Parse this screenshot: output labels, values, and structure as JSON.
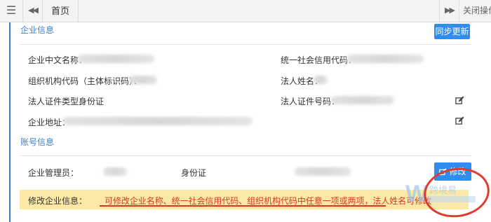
{
  "topbar": {
    "home_tab": "首页",
    "close_ops": "关闭操作"
  },
  "enterprise": {
    "section_title": "企业信息",
    "sync_button": "同步更新",
    "fields": {
      "cn_name_label": "企业中文名称：",
      "credit_code_label": "统一社会信用代码：",
      "org_code_label": "组织机构代码（主体标识码）：",
      "legal_name_label": "法人姓名：",
      "id_type_label": "法人证件类型：",
      "id_type_value": "身份证",
      "id_number_label": "法人证件号码：",
      "address_label": "企业地址："
    }
  },
  "account": {
    "section_title": "账号信息",
    "admin_label": "企业管理员：",
    "id_type_value": "身份证",
    "edit_button": "修改"
  },
  "notice": {
    "label": "修改企业信息：",
    "text": "可修改企业名称、统一社会信用代码、组织机构代码中任意一项或两项，法人姓名可修改"
  },
  "colors": {
    "accent": "#2e8ded",
    "section_blue": "#3a7fd5",
    "notice_bg": "#fde9a6",
    "notice_text": "#d9352b"
  },
  "icons": {
    "menu": "hamburger-icon",
    "back": "double-left-icon",
    "forward": "double-right-icon",
    "edit": "edit-icon"
  }
}
